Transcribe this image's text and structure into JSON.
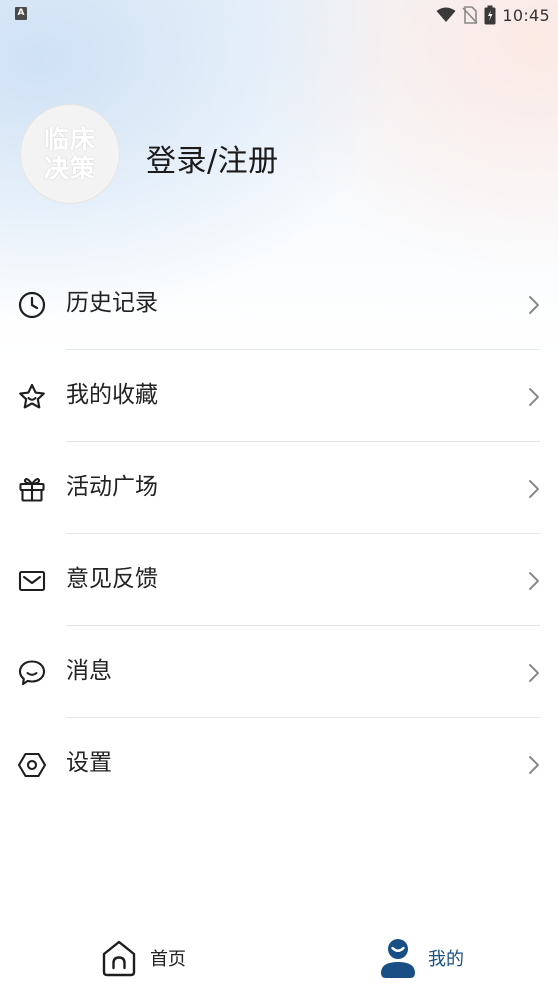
{
  "status_bar": {
    "time": "10:45",
    "notification_icon": "a-badge-icon"
  },
  "profile": {
    "avatar_text_line1": "临床",
    "avatar_text_line2": "决策",
    "login_label": "登录/注册"
  },
  "menu": [
    {
      "icon": "clock-icon",
      "label": "历史记录"
    },
    {
      "icon": "star-icon",
      "label": "我的收藏"
    },
    {
      "icon": "gift-icon",
      "label": "活动广场"
    },
    {
      "icon": "mail-icon",
      "label": "意见反馈"
    },
    {
      "icon": "chat-icon",
      "label": "消息"
    },
    {
      "icon": "settings-hex-icon",
      "label": "设置"
    }
  ],
  "bottom_nav": {
    "home_label": "首页",
    "mine_label": "我的"
  },
  "colors": {
    "accent": "#1a4f86",
    "text": "#222222",
    "chevron": "#8a8a8a",
    "divider": "#e6e6e6"
  }
}
